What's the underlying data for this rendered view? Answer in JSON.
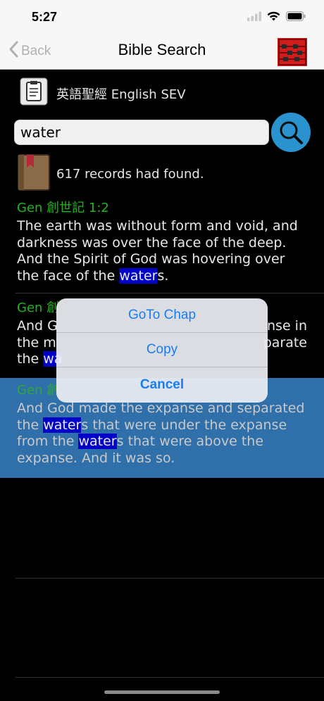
{
  "status_bar": {
    "time": "5:27"
  },
  "nav": {
    "back_label": "Back",
    "title": "Bible Search"
  },
  "version": {
    "label": "英語聖經 English SEV"
  },
  "search": {
    "value": "water"
  },
  "results_header": {
    "count_text": "617 records had found."
  },
  "results": [
    {
      "ref": "Gen 創世記 1:2",
      "text_parts": [
        "The earth was without form and void, and darkness was over the face of the deep. And the Spirit of God was hovering over the face of the ",
        "water",
        "s."
      ]
    },
    {
      "ref": "Gen 創",
      "line1": "And G",
      "line1_tail": "nse in",
      "line2": "the m",
      "line2_tail": "parate",
      "line3": "the ",
      "line3_hl": "wa"
    },
    {
      "ref": "Gen 創",
      "text_parts": [
        "And God made the expanse and separated the ",
        "water",
        "s that were under the expanse from the ",
        "water",
        "s that were above the expanse. And it was so."
      ]
    }
  ],
  "action_sheet": {
    "goto_label": "GoTo Chap",
    "copy_label": "Copy",
    "cancel_label": "Cancel"
  },
  "colors": {
    "reference_green": "#1fb51f",
    "highlight_blue": "#0000c8",
    "selected_row": "#2f6faa",
    "accent_blue": "#1a7df0"
  }
}
